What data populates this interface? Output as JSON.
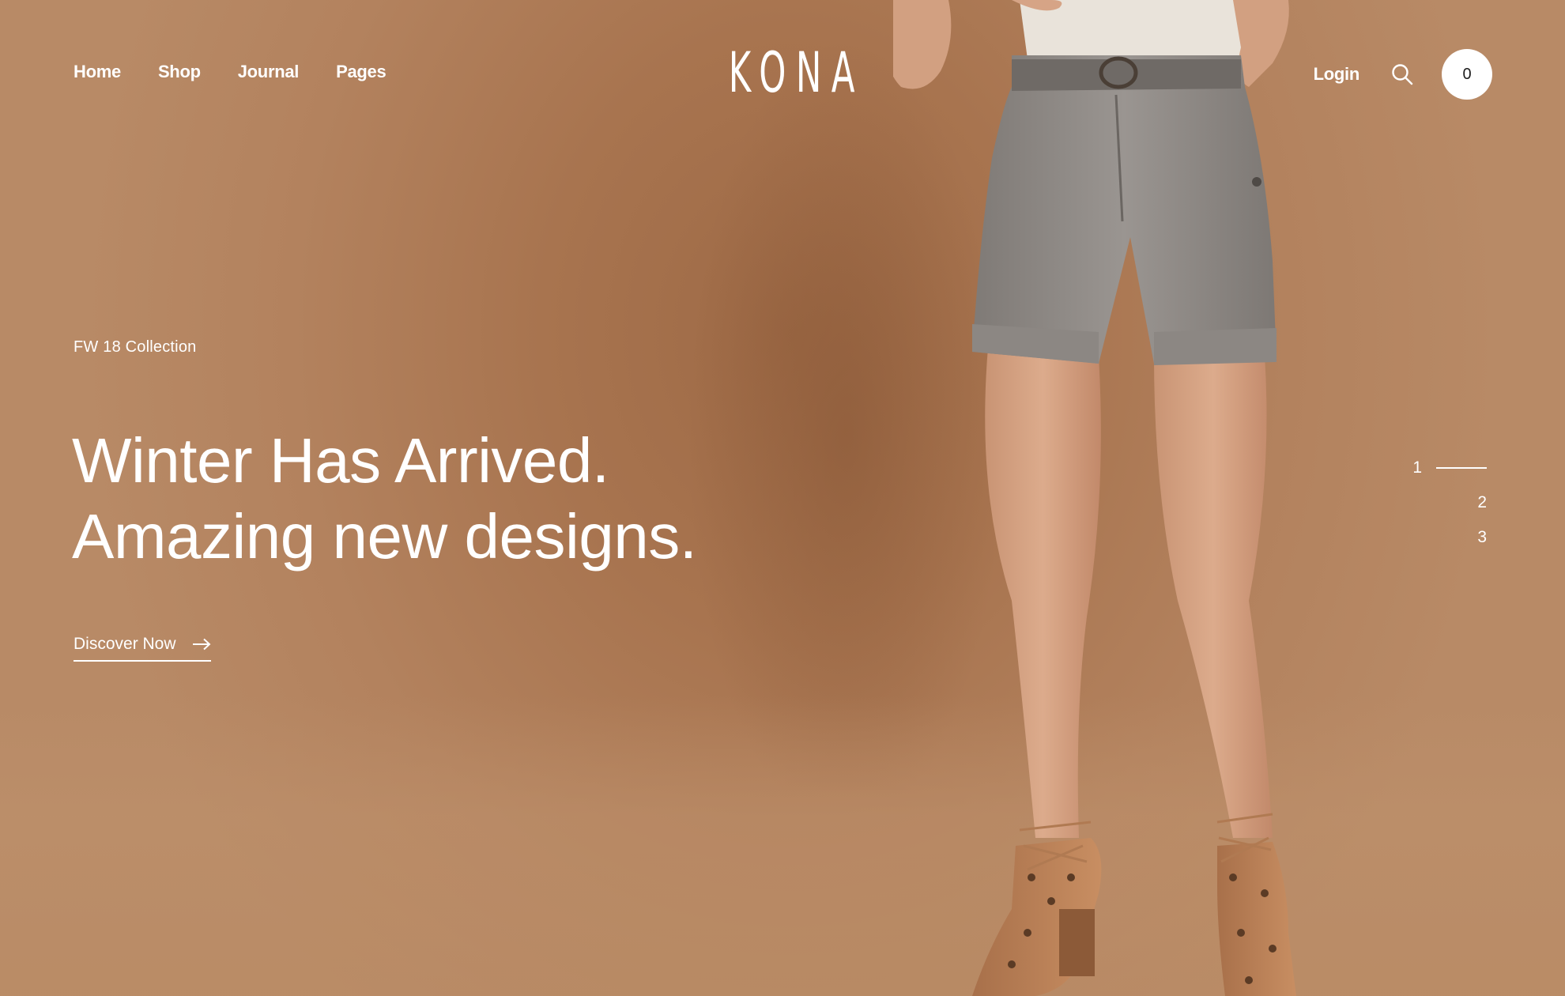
{
  "header": {
    "nav": [
      {
        "label": "Home"
      },
      {
        "label": "Shop"
      },
      {
        "label": "Journal"
      },
      {
        "label": "Pages"
      }
    ],
    "logo": "KONA",
    "login_label": "Login",
    "search_icon": "search-icon",
    "cart_count": "0"
  },
  "hero": {
    "eyebrow": "FW 18 Collection",
    "headline_line1": "Winter Has Arrived.",
    "headline_line2": "Amazing new designs.",
    "cta_label": "Discover Now",
    "cta_icon": "arrow-right-icon",
    "image": "model-wearing-grey-linen-shorts-and-lace-up-sandals"
  },
  "slider": {
    "pages": [
      "1",
      "2",
      "3"
    ],
    "active": "1"
  },
  "colors": {
    "background": "#a8744f",
    "text": "#ffffff",
    "cart_bg": "#ffffff"
  }
}
